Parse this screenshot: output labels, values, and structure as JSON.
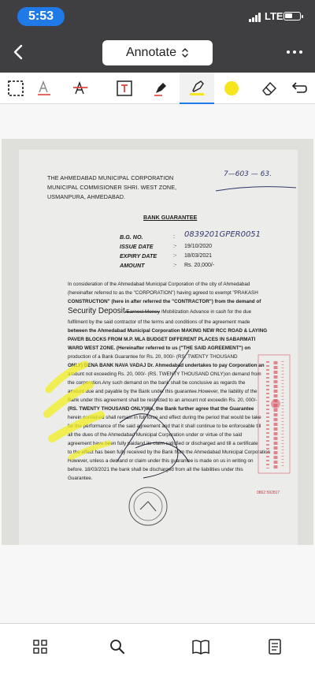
{
  "status_bar": {
    "time": "5:53",
    "network": "LTE"
  },
  "nav": {
    "title": "Annotate"
  },
  "document": {
    "ref_handwritten": "7—603 — 63.",
    "address": [
      "THE AHMEDABAD MUNICIPAL CORPORATION",
      "MUNICIPAL COMMISIONER SHRI. WEST ZONE,",
      "USMANPURA, AHMEDABAD."
    ],
    "heading": "BANK GUARANTEE",
    "fields": [
      {
        "label": "B.G. NO.",
        "sep": ":",
        "value": "0839201GPER0051"
      },
      {
        "label": "ISSUE DATE",
        "sep": ":-",
        "value": "19/10/2020"
      },
      {
        "label": "EXPIRY DATE",
        "sep": ":-",
        "value": "18/03/2021"
      },
      {
        "label": "AMOUNT",
        "sep": ":-",
        "value": "Rs. 20,000/-"
      }
    ],
    "para1": [
      "In consideration of the Ahmedabad Municipal Corporation of the city of Ahmedabad",
      "(hereinafter referred to as the \"CORPORATION\") having agreed to exempt \"PRAKASH",
      "CONSTRUCTION\" (here in after referred the \"CONTRACTOR\") from the demand of"
    ],
    "security_deposit": "Security Deposit",
    "earnest_money": "/Earnest Money",
    "para1_tail": " /Mobilization Advance in cash for the due",
    "para2": [
      "fulfilment by the said contractor of the terms and conditions of the agreement made",
      "between the Ahmedabad Municipal Corporation MAKING NEW RCC ROAD & LAYING",
      "PAVER BLOCKS FROM M.P. MLA BUDGET DIFFERENT PLACES IN SABARMATI",
      "WARD WEST ZONE. (Hereinafter referred to us (\"THE SAID AGREEMENT\") on",
      "production of a Bank Guarantee for Rs. 20, 000/- (RS. TWENTY THOUSAND",
      "ONLY) DENA BANK NAVA VADAJ Dr. Ahmedabad undertakes to pay Corporation an",
      "amount not exceeding Rs. 20, 000/- (RS. TWENTY THOUSAND ONLY)on demand from",
      "the corporation.Any such demand on the bank shall be conclusive as regards the",
      "amount due and payable by the Bank under this guarantee.However, the liability of the",
      "Bank under this agreement shall be restricted to an amount not exceedin Rs. 20, 000/-",
      "(RS. TWENTY THOUSAND ONLY)We, the Bank further agree that the Guarantee",
      "herein contained shall remain in full force and effect during the period that would be take",
      "for the performance of the said agreement and that it shall continue to be enforceable till",
      "all the dues of the Ahmedabad Municipal Corporation under or  virtue of the said",
      "agreement have been fully paidand its claim satisfied or discharged and till a certificate",
      "to the effect has been fully received by the Bank from the Ahmedabad Municipal Corporation",
      "However, unless a demand or claim under this guarantee is made on us in writing on",
      "before. 18/03/2021 the bank shall be discharged from all the liabilities under this",
      "Guarantee."
    ],
    "stamp_number": "0862 592817"
  },
  "bottom_bar": {}
}
